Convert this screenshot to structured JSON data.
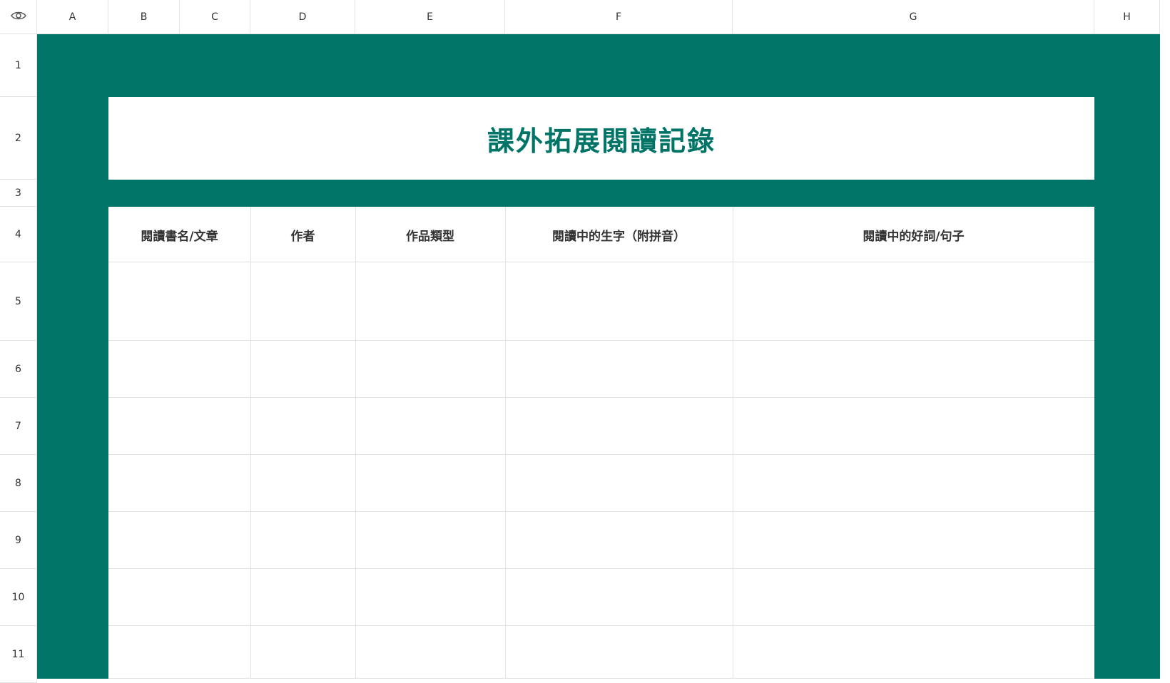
{
  "sheet": {
    "columns": [
      "A",
      "B",
      "C",
      "D",
      "E",
      "F",
      "G",
      "H"
    ],
    "rows": [
      "1",
      "2",
      "3",
      "4",
      "5",
      "6",
      "7",
      "8",
      "9",
      "10",
      "11"
    ],
    "title": "課外拓展閱讀記錄",
    "headers": [
      "閱讀書名/文章",
      "作者",
      "作品類型",
      "閱讀中的生字（附拼音）",
      "閱讀中的好詞/句子"
    ],
    "accent_color": "#007466",
    "corner_icon": "eye-icon"
  }
}
